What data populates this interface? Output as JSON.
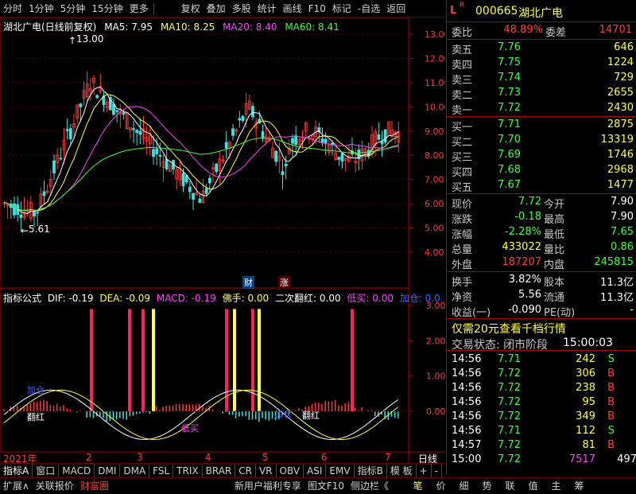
{
  "toolbar": {
    "left_buttons": [
      "分时",
      "1分钟",
      "5分钟",
      "15分钟",
      "更多"
    ],
    "right_buttons": [
      "复权",
      "叠加",
      "多股",
      "统计",
      "画线",
      "F10",
      "标记",
      "-自选",
      "返回"
    ]
  },
  "header": {
    "stock_line": "湖北广电(日线前复权)",
    "ma5": "MA5: 7.95",
    "ma10": "MA10: 8.25",
    "ma20": "MA20: 8.40",
    "ma60": "MA60: 8.41",
    "high_mark": "13.00",
    "low_mark": "5.61"
  },
  "price_axis": [
    "13.00",
    "12.00",
    "11.00",
    "10.00",
    "9.00",
    "8.00",
    "7.00",
    "6.00",
    "5.00",
    "4.00"
  ],
  "indicator": {
    "title": "指标公式",
    "dif": "DIF: -0.19",
    "dea": "DEA: -0.09",
    "macd": "MACD: -0.19",
    "fs": "佛手: 0.00",
    "ecfh": "二次翻红: 0.00",
    "dm": "低买: 0.00",
    "jc": "加仓: 0.0",
    "axis": [
      "3.00",
      "2.00",
      "1.00",
      "0.00"
    ],
    "annotations": [
      "加仓",
      "翻红",
      "低买",
      "加仓",
      "翻红"
    ]
  },
  "markers": {
    "caibao": "财",
    "zhang": "涨"
  },
  "date_axis": {
    "year": "2021年",
    "months": [
      "2",
      "3",
      "4",
      "5",
      "6",
      "7"
    ],
    "period": "日线"
  },
  "tabs": [
    "指标A",
    "窗口",
    "MACD",
    "DMI",
    "DMA",
    "FSL",
    "TRIX",
    "BRAR",
    "CR",
    "VR",
    "OBV",
    "ASI",
    "EMV",
    "指标B",
    "模 板",
    "+",
    "-"
  ],
  "bottom": [
    "扩展∧",
    "关联报价",
    "财富圈",
    "新用户福利专享",
    "图文F10",
    "侧边栏《",
    "笔",
    "价",
    "细",
    "势",
    "联",
    "值",
    "主",
    "筹"
  ],
  "quote": {
    "code": "000665",
    "name": "湖北广电",
    "weibi_label": "委比",
    "weibi": "48.89%",
    "weicha_label": "委差",
    "weicha": "14701",
    "asks": [
      {
        "label": "卖五",
        "price": "7.76",
        "vol": "646"
      },
      {
        "label": "卖四",
        "price": "7.75",
        "vol": "1224"
      },
      {
        "label": "卖三",
        "price": "7.74",
        "vol": "729"
      },
      {
        "label": "卖二",
        "price": "7.73",
        "vol": "2655"
      },
      {
        "label": "卖一",
        "price": "7.72",
        "vol": "2430"
      }
    ],
    "bids": [
      {
        "label": "买一",
        "price": "7.71",
        "vol": "2875"
      },
      {
        "label": "买二",
        "price": "7.70",
        "vol": "13319"
      },
      {
        "label": "买三",
        "price": "7.69",
        "vol": "1746"
      },
      {
        "label": "买四",
        "price": "7.68",
        "vol": "2968"
      },
      {
        "label": "买五",
        "price": "7.67",
        "vol": "1477"
      }
    ],
    "stats": [
      {
        "l1": "现价",
        "v1": "7.72",
        "c1": "green",
        "l2": "今开",
        "v2": "7.90",
        "c2": "white"
      },
      {
        "l1": "涨跌",
        "v1": "-0.18",
        "c1": "green",
        "l2": "最高",
        "v2": "7.90",
        "c2": "white"
      },
      {
        "l1": "涨幅",
        "v1": "-2.28%",
        "c1": "green",
        "l2": "最低",
        "v2": "7.65",
        "c2": "green"
      },
      {
        "l1": "总量",
        "v1": "433022",
        "c1": "yellow",
        "l2": "量比",
        "v2": "0.86",
        "c2": "green"
      },
      {
        "l1": "外盘",
        "v1": "187207",
        "c1": "red",
        "l2": "内盘",
        "v2": "245815",
        "c2": "green"
      }
    ],
    "stats2": [
      {
        "l1": "换手",
        "v1": "3.82%",
        "l2": "股本",
        "v2": "11.3亿"
      },
      {
        "l1": "净资",
        "v1": "5.56",
        "l2": "流通",
        "v2": "11.3亿"
      },
      {
        "l1": "收益(一)",
        "v1": "-0.090",
        "l2": "PE(动)",
        "v2": "-"
      }
    ],
    "promo": "仅需20元查看千档行情",
    "status_label": "交易状态: 闭市阶段",
    "status_time": "15:00:03",
    "ticks": [
      {
        "t": "14:56",
        "p": "7.71",
        "v": "242",
        "s": "S",
        "pc": "green",
        "sc": "green"
      },
      {
        "t": "14:56",
        "p": "7.72",
        "v": "306",
        "s": "B",
        "pc": "green",
        "sc": "red"
      },
      {
        "t": "14:56",
        "p": "7.72",
        "v": "238",
        "s": "B",
        "pc": "green",
        "sc": "red"
      },
      {
        "t": "14:56",
        "p": "7.72",
        "v": "95",
        "s": "B",
        "pc": "green",
        "sc": "red"
      },
      {
        "t": "14:56",
        "p": "7.72",
        "v": "349",
        "s": "B",
        "pc": "green",
        "sc": "red"
      },
      {
        "t": "14:56",
        "p": "7.71",
        "v": "112",
        "s": "S",
        "pc": "green",
        "sc": "green"
      },
      {
        "t": "14:57",
        "p": "7.72",
        "v": "81",
        "s": "B",
        "pc": "green",
        "sc": "red"
      },
      {
        "t": "15:00",
        "p": "7.72",
        "v": "7517",
        "s": "497",
        "pc": "green",
        "sc": "white"
      }
    ]
  }
}
